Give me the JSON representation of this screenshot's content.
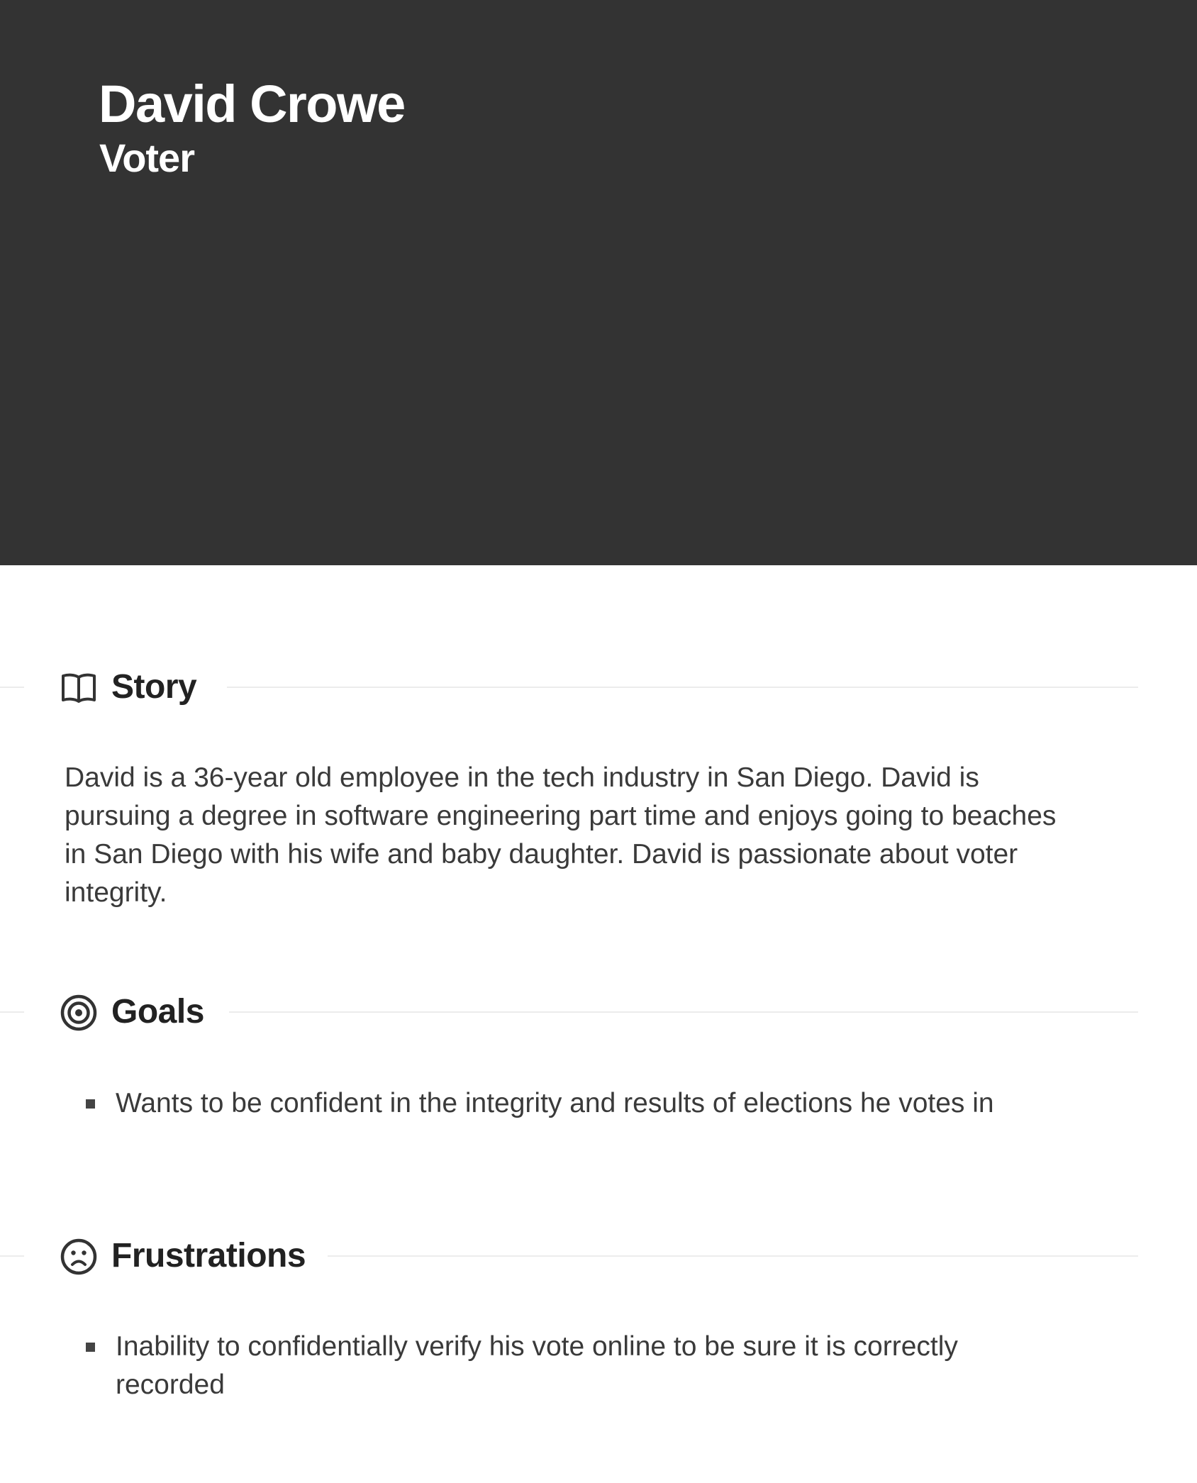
{
  "persona": {
    "name": "David Crowe",
    "role": "Voter"
  },
  "sections": {
    "story": {
      "icon": "open-book-icon",
      "title": "Story",
      "text": "David is a 36-year old employee in the tech industry in San Diego. David is pursuing a degree in software engineering part time and enjoys going to beaches in San Diego with his wife and baby daughter. David is passionate about voter integrity."
    },
    "goals": {
      "icon": "target-icon",
      "title": "Goals",
      "items": [
        "Wants to be confident in the integrity and results of elections he votes in"
      ]
    },
    "frustrations": {
      "icon": "sad-face-icon",
      "title": "Frustrations",
      "items": [
        "Inability to confidentially verify his vote online to be sure it is correctly recorded"
      ]
    }
  },
  "colors": {
    "hero_background": "#333333",
    "hero_text": "#ffffff",
    "body_text": "#3a3a3a",
    "divider": "#ececec"
  }
}
